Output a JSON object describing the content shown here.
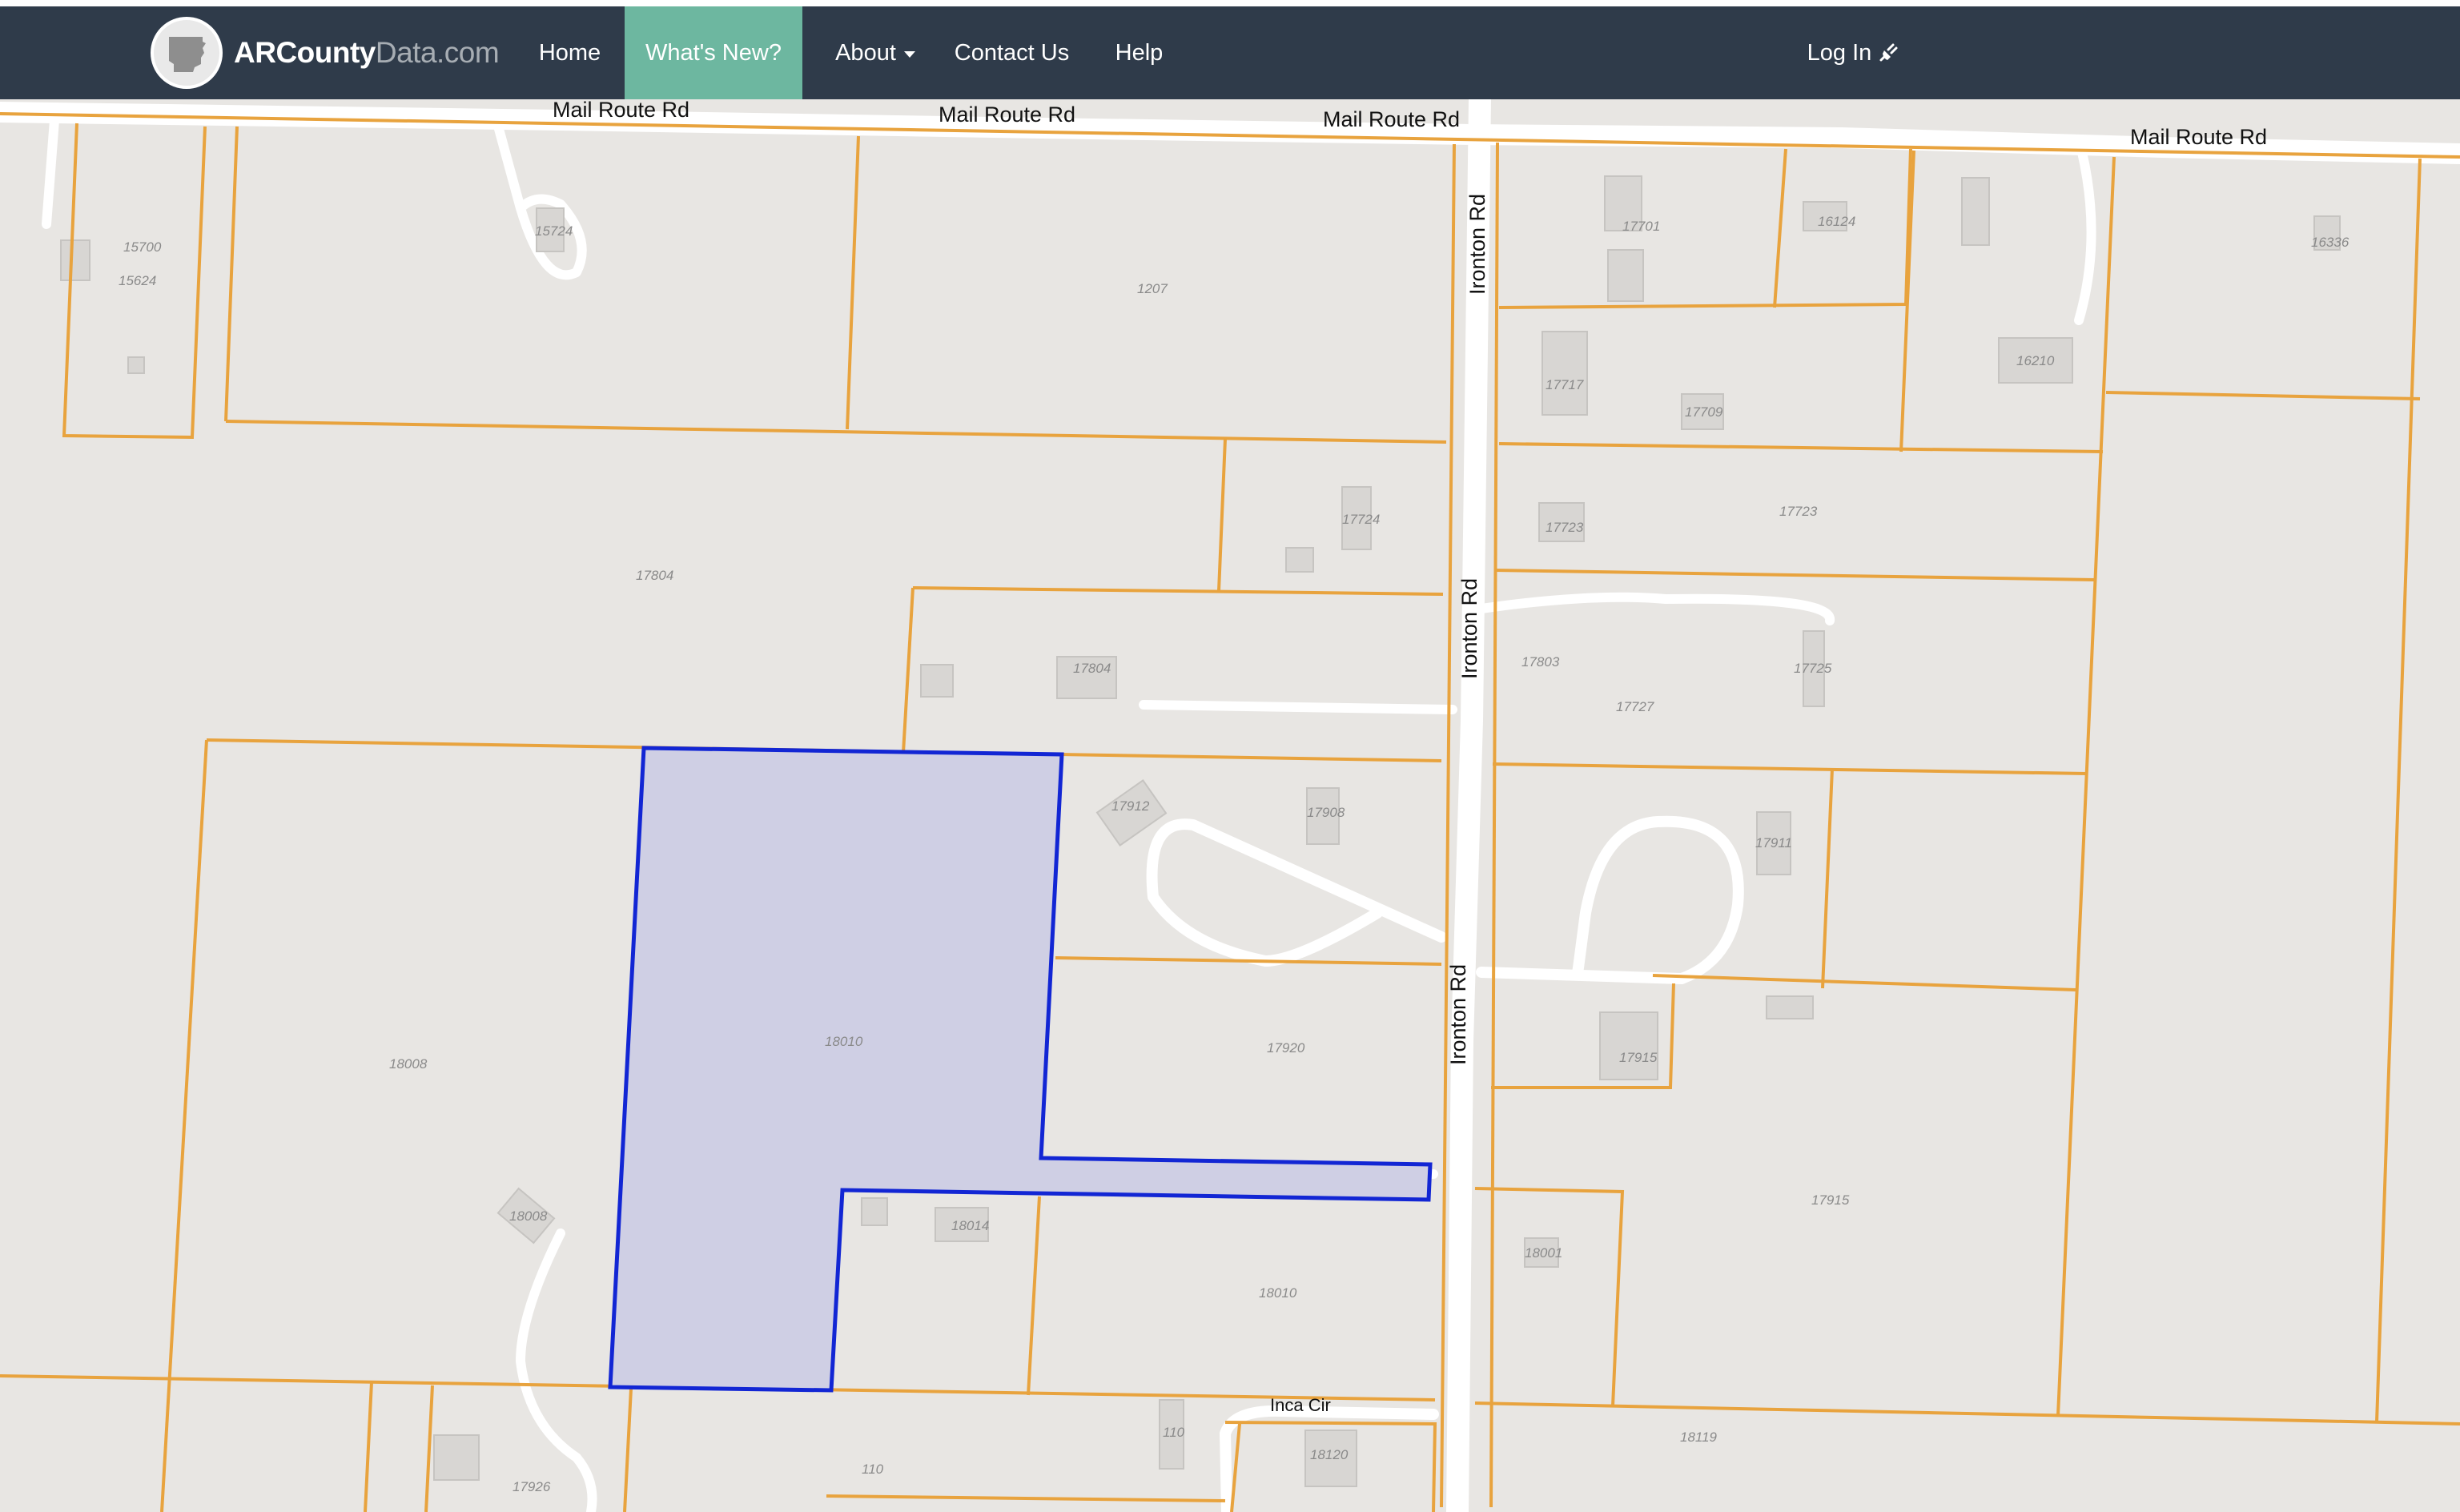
{
  "nav": {
    "brand_main": "ARCounty",
    "brand_suffix": "Data.com",
    "items": [
      {
        "label": "Home"
      },
      {
        "label": "What's New?"
      },
      {
        "label": "About"
      },
      {
        "label": "Contact Us"
      },
      {
        "label": "Help"
      }
    ],
    "login_label": "Log In",
    "accent_color": "#6db7a0",
    "bar_color": "#2f3b4a",
    "icons": {
      "logo": "arkansas-state-icon",
      "login": "plug-icon",
      "about": "caret-down-icon"
    }
  },
  "map": {
    "roads": [
      "Mail Route Rd",
      "Mail Route Rd",
      "Mail Route Rd",
      "Mail Route Rd",
      "Ironton Rd",
      "Ironton Rd",
      "Ironton Rd",
      "Inca Cir"
    ],
    "addresses": [
      "15700",
      "15624",
      "15724",
      "1207",
      "17804",
      "17724",
      "17804",
      "17912",
      "17908",
      "18010",
      "18008",
      "17920",
      "18008",
      "18014",
      "18010",
      "17926",
      "110",
      "110",
      "18120",
      "17701",
      "16124",
      "16336",
      "17717",
      "17709",
      "16210",
      "17723",
      "17723",
      "17803",
      "17725",
      "17727",
      "17911",
      "17915",
      "17915",
      "18001",
      "18119"
    ],
    "parcel_color": "#e8a33e",
    "selected_color": "#1226d4",
    "selected_fill": "#cfcfe4"
  }
}
